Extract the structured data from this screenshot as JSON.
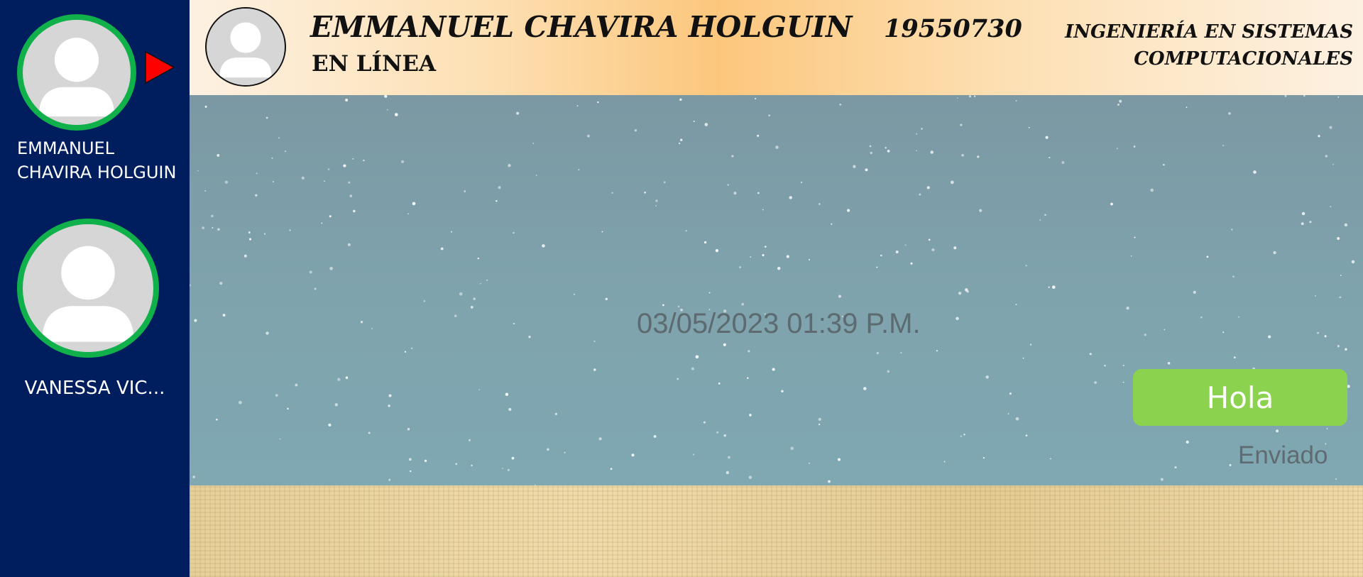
{
  "sidebar": {
    "contacts": [
      {
        "name": "EMMANUEL CHAVIRA HOLGUIN",
        "active": true
      },
      {
        "name": "VANESSA VIC..."
      }
    ],
    "active_indicator_icon": "play-triangle-icon",
    "ring_color": "#10b04a",
    "background": "#001e5e"
  },
  "header": {
    "name": "EMMANUEL CHAVIRA HOLGUIN",
    "status": "EN LÍNEA",
    "id": "19550730",
    "career": "INGENIERÍA EN SISTEMAS COMPUTACIONALES",
    "avatar_icon": "user-avatar-icon"
  },
  "chat": {
    "timestamp": "03/05/2023 01:39 P.M.",
    "messages": [
      {
        "text": "Hola",
        "status": "Enviado",
        "bubble_color": "#8bd24f"
      }
    ]
  }
}
